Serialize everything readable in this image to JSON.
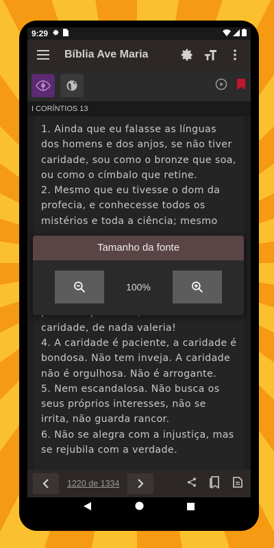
{
  "status": {
    "time": "9:29"
  },
  "appbar": {
    "title": "Bíblia Ave Maria"
  },
  "chapter": {
    "label": "I CORÍNTIOS 13"
  },
  "verses": [
    "1. Ainda que eu falasse as línguas dos homens e dos anjos, se não tiver caridade, sou como o bronze que soa, ou como o címbalo que retine.",
    "2. Mesmo que eu tivesse o dom da profecia, e conhecesse todos os mistérios e toda a ciência; mesmo",
    "e ainda que entregasse o meu corpo para ser queimado, se não tiver caridade, de nada valeria!",
    "4. A caridade é paciente, a caridade é bondosa. Não tem inveja. A caridade não é orgulhosa. Não é arrogante.",
    "5. Nem escandalosa. Não busca os seus próprios interesses, não se irrita, não guarda rancor.",
    "6. Não se alegra com a injustiça, mas se rejubila com a verdade."
  ],
  "font_dialog": {
    "title": "Tamanho da fonte",
    "value": "100%",
    "decrease_icon": "zoom-out-icon",
    "increase_icon": "zoom-in-icon"
  },
  "pager": {
    "label": "1220 de 1334"
  },
  "colors": {
    "accent": "#5b2a72",
    "bookmark": "#c0152b",
    "dialog_header": "#5a4446"
  }
}
